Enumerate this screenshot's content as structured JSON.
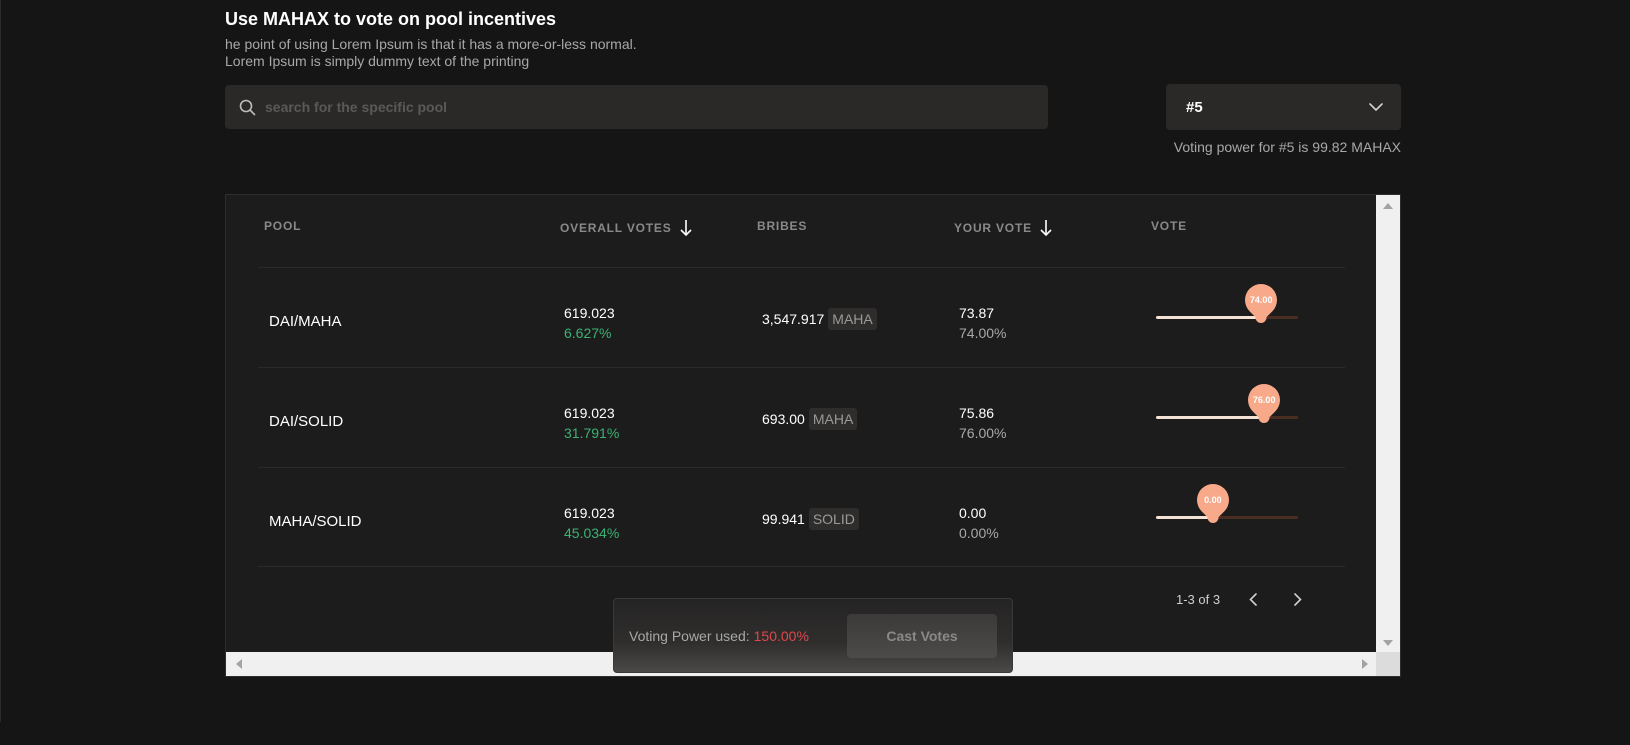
{
  "header": {
    "title": "Use MAHAX to vote on pool incentives",
    "subtitle_line1": "he point of using Lorem Ipsum is that it has a more-or-less normal.",
    "subtitle_line2": "Lorem Ipsum is simply dummy text of the printing"
  },
  "search": {
    "placeholder": "search for the specific pool",
    "icon": "search-icon"
  },
  "nft_select": {
    "value": "#5",
    "icon": "chevron-down-icon"
  },
  "voting_power_info": "Voting power for #5 is  99.82 MAHAX",
  "table": {
    "columns": {
      "pool": "POOL",
      "overall_votes": "OVERALL VOTES",
      "bribes": "BRIBES",
      "your_vote": "YOUR VOTE",
      "vote": "VOTE"
    },
    "rows": [
      {
        "pool": "DAI/MAHA",
        "overall_votes": "619.023",
        "overall_pct": "6.627%",
        "bribe_amount": "3,547.917",
        "bribe_token": "MAHA",
        "your_vote": "73.87",
        "your_pct": "74.00%",
        "slider_label": "74.00",
        "slider_value": 74
      },
      {
        "pool": "DAI/SOLID",
        "overall_votes": "619.023",
        "overall_pct": "31.791%",
        "bribe_amount": "693.00",
        "bribe_token": "MAHA",
        "your_vote": "75.86",
        "your_pct": "76.00%",
        "slider_label": "76.00",
        "slider_value": 76
      },
      {
        "pool": "MAHA/SOLID",
        "overall_votes": "619.023",
        "overall_pct": "45.034%",
        "bribe_amount": "99.941",
        "bribe_token": "SOLID",
        "your_vote": "0.00",
        "your_pct": "0.00%",
        "slider_label": "0.00",
        "slider_value": 40
      }
    ]
  },
  "pagination": {
    "text": "1-3 of 3"
  },
  "footer_bar": {
    "label": "Voting Power used:",
    "value": "150.00%",
    "cast_button": "Cast Votes"
  },
  "colors": {
    "background": "#161515",
    "accent": "#f7a98a",
    "positive": "#3bb273",
    "negative": "#e0474c"
  }
}
